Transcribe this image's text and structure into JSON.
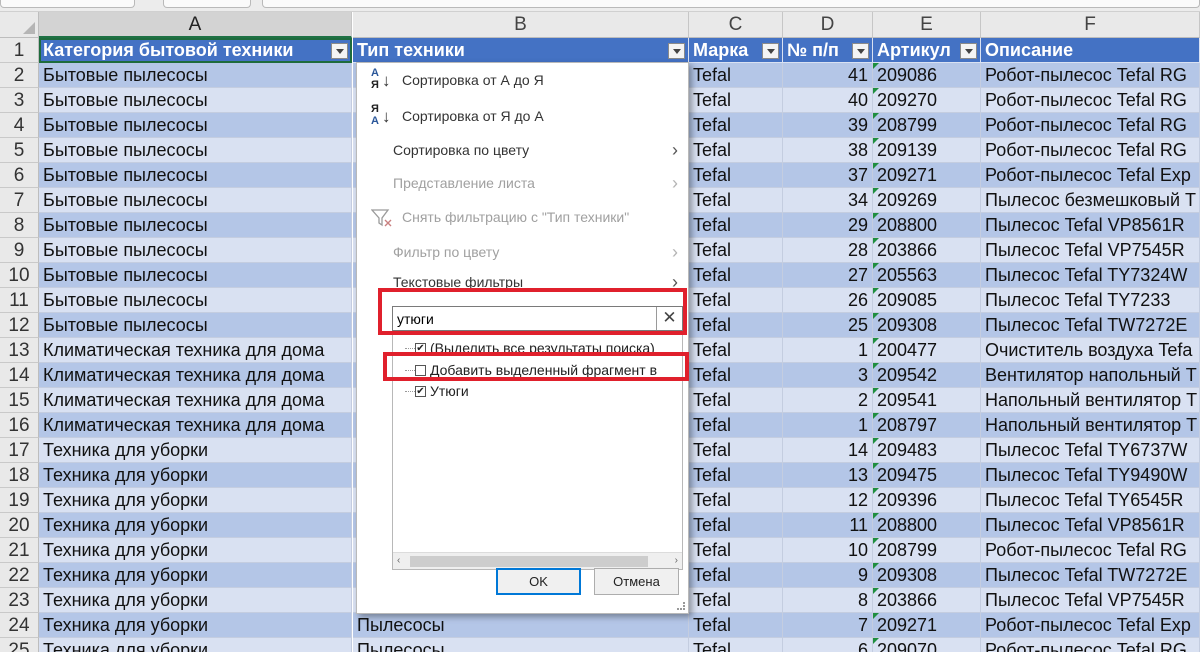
{
  "col_headers": [
    "A",
    "B",
    "C",
    "D",
    "E",
    "F"
  ],
  "table_headers": [
    "Категория бытовой техники",
    "Тип техники",
    "Марка",
    "№ п/п",
    "Артикул",
    "Описание"
  ],
  "rows": [
    {
      "n": "2",
      "a": "Бытовые пылесосы",
      "b": "",
      "c": "Tefal",
      "d": "41",
      "e": "209086",
      "f": "Робот-пылесос Tefal RG"
    },
    {
      "n": "3",
      "a": "Бытовые пылесосы",
      "b": "",
      "c": "Tefal",
      "d": "40",
      "e": "209270",
      "f": "Робот-пылесос Tefal RG"
    },
    {
      "n": "4",
      "a": "Бытовые пылесосы",
      "b": "",
      "c": "Tefal",
      "d": "39",
      "e": "208799",
      "f": "Робот-пылесос Tefal RG"
    },
    {
      "n": "5",
      "a": "Бытовые пылесосы",
      "b": "",
      "c": "Tefal",
      "d": "38",
      "e": "209139",
      "f": "Робот-пылесос Tefal RG"
    },
    {
      "n": "6",
      "a": "Бытовые пылесосы",
      "b": "",
      "c": "Tefal",
      "d": "37",
      "e": "209271",
      "f": "Робот-пылесос Tefal Exp"
    },
    {
      "n": "7",
      "a": "Бытовые пылесосы",
      "b": "",
      "c": "Tefal",
      "d": "34",
      "e": "209269",
      "f": "Пылесос безмешковый T"
    },
    {
      "n": "8",
      "a": "Бытовые пылесосы",
      "b": "",
      "c": "Tefal",
      "d": "29",
      "e": "208800",
      "f": "Пылесос Tefal VP8561R"
    },
    {
      "n": "9",
      "a": "Бытовые пылесосы",
      "b": "",
      "c": "Tefal",
      "d": "28",
      "e": "203866",
      "f": "Пылесос Tefal VP7545R"
    },
    {
      "n": "10",
      "a": "Бытовые пылесосы",
      "b": "",
      "c": "Tefal",
      "d": "27",
      "e": "205563",
      "f": "Пылесос Tefal TY7324W"
    },
    {
      "n": "11",
      "a": "Бытовые пылесосы",
      "b": "",
      "c": "Tefal",
      "d": "26",
      "e": "209085",
      "f": "Пылесос Tefal TY7233"
    },
    {
      "n": "12",
      "a": "Бытовые пылесосы",
      "b": "",
      "c": "Tefal",
      "d": "25",
      "e": "209308",
      "f": "Пылесос Tefal TW7272E"
    },
    {
      "n": "13",
      "a": "Климатическая техника для дома",
      "b": "",
      "c": "Tefal",
      "d": "1",
      "e": "200477",
      "f": "Очиститель воздуха Tefa"
    },
    {
      "n": "14",
      "a": "Климатическая техника для дома",
      "b": "",
      "c": "Tefal",
      "d": "3",
      "e": "209542",
      "f": "Вентилятор напольный Т"
    },
    {
      "n": "15",
      "a": "Климатическая техника для дома",
      "b": "",
      "c": "Tefal",
      "d": "2",
      "e": "209541",
      "f": "Напольный вентилятор Т"
    },
    {
      "n": "16",
      "a": "Климатическая техника для дома",
      "b": "",
      "c": "Tefal",
      "d": "1",
      "e": "208797",
      "f": "Напольный вентилятор Т"
    },
    {
      "n": "17",
      "a": "Техника для уборки",
      "b": "",
      "c": "Tefal",
      "d": "14",
      "e": "209483",
      "f": "Пылесос Tefal TY6737W"
    },
    {
      "n": "18",
      "a": "Техника для уборки",
      "b": "",
      "c": "Tefal",
      "d": "13",
      "e": "209475",
      "f": "Пылесос Tefal TY9490W"
    },
    {
      "n": "19",
      "a": "Техника для уборки",
      "b": "",
      "c": "Tefal",
      "d": "12",
      "e": "209396",
      "f": "Пылесос Tefal TY6545R"
    },
    {
      "n": "20",
      "a": "Техника для уборки",
      "b": "",
      "c": "Tefal",
      "d": "11",
      "e": "208800",
      "f": "Пылесос Tefal VP8561R"
    },
    {
      "n": "21",
      "a": "Техника для уборки",
      "b": "",
      "c": "Tefal",
      "d": "10",
      "e": "208799",
      "f": "Робот-пылесос Tefal RG"
    },
    {
      "n": "22",
      "a": "Техника для уборки",
      "b": "",
      "c": "Tefal",
      "d": "9",
      "e": "209308",
      "f": "Пылесос Tefal TW7272E"
    },
    {
      "n": "23",
      "a": "Техника для уборки",
      "b": "",
      "c": "Tefal",
      "d": "8",
      "e": "203866",
      "f": "Пылесос Tefal VP7545R"
    },
    {
      "n": "24",
      "a": "Техника для уборки",
      "b": "Пылесосы",
      "c": "Tefal",
      "d": "7",
      "e": "209271",
      "f": "Робот-пылесос Tefal Exp"
    },
    {
      "n": "25",
      "a": "Техника для уборки",
      "b": "Пылесосы",
      "c": "Tefal",
      "d": "6",
      "e": "209070",
      "f": "Робот-пылесос Tefal RG"
    }
  ],
  "filter_menu": {
    "sort_asc": "Сортировка от А до Я",
    "sort_desc": "Сортировка от Я до А",
    "sort_by_color": "Сортировка по цвету",
    "sheet_view": "Представление листа",
    "clear_filter": "Снять фильтрацию с \"Тип техники\"",
    "filter_by_color": "Фильтр по цвету",
    "text_filters": "Текстовые фильтры",
    "search_value": "утюги",
    "select_all_results": "(Выделить все результаты поиска)",
    "add_selection": "Добавить выделенный фрагмент в",
    "item_irons": "Утюги",
    "ok": "OK",
    "cancel": "Отмена",
    "icons": {
      "sort_asc": "sort-az-icon",
      "sort_desc": "sort-za-icon",
      "clear_filter": "funnel-clear-icon",
      "submenu": "chevron-right-icon",
      "clear_search": "close-icon"
    }
  },
  "colors": {
    "header_blue": "#4472c4",
    "band_dark": "#b4c6e7",
    "band_light": "#d9e1f2",
    "highlight_red": "#e0202c"
  }
}
